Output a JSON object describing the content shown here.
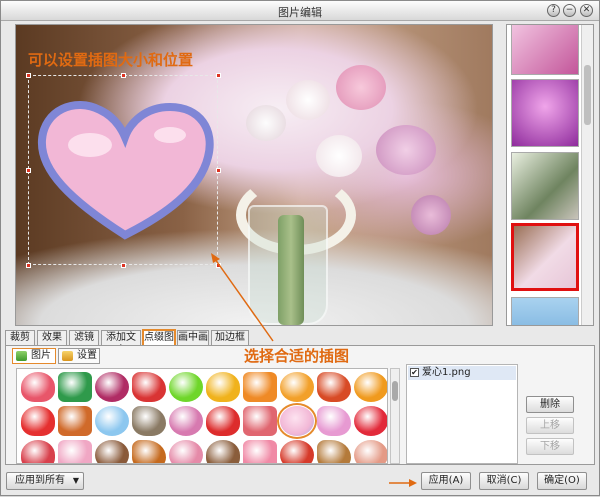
{
  "window": {
    "title": "图片编辑",
    "buttons": [
      "?",
      "−",
      "□",
      "✕"
    ]
  },
  "canvas": {
    "hint": "可以设置插图大小和位置"
  },
  "tabs": [
    "裁剪",
    "效果",
    "滤镜",
    "添加文字",
    "点缀图",
    "画中画",
    "加边框"
  ],
  "active_tab": "点缀图",
  "subtabs": {
    "pictures": "图片",
    "settings": "设置"
  },
  "annotation": "选择合适的插图",
  "stickers": [
    "heart-banner-icon",
    "bird-icon",
    "origami-bird-icon",
    "red-bird-icon",
    "starburst-icon",
    "duck-icon",
    "fox-icon",
    "orange-icon",
    "dinosaur-icon",
    "banner-icon",
    "ladybug-balloon-icon",
    "flowerpot-icon",
    "cloud-icon",
    "cat-icon",
    "seahorse-icon",
    "splash-icon",
    "heart-face-icon",
    "heart-outline-icon",
    "small-hearts-icon",
    "heart-lollipop-icon",
    "heart-pair-icon",
    "heart-ring-icon",
    "puppy-icon",
    "lion-icon",
    "flower-icon",
    "bear-icon",
    "bird-pink-icon",
    "beetle-icon",
    "dog-icon",
    "cake-icon"
  ],
  "layers": [
    {
      "name": "爱心1.png",
      "checked": true
    }
  ],
  "side_buttons": {
    "delete": "删除",
    "up": "上移",
    "down": "下移"
  },
  "footer": {
    "apply_all": "应用到所有",
    "apply": "应用(A)",
    "cancel": "取消(C)",
    "ok": "确定(O)"
  },
  "colors": {
    "accent": "#e06a12",
    "selected": "#e58a2c",
    "thumb_selected": "#e01010"
  }
}
